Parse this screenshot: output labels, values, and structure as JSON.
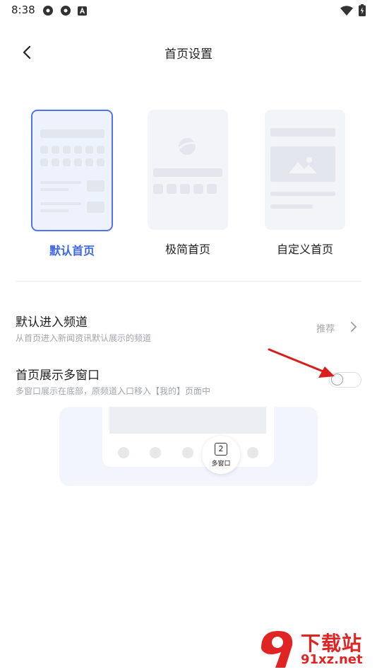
{
  "status_bar": {
    "time": "8:38",
    "left_icons": [
      "app-icon-1",
      "app-icon-2",
      "a-box-icon"
    ],
    "right_icons": [
      "wifi-icon",
      "battery-charging-icon"
    ]
  },
  "nav": {
    "title": "首页设置",
    "back_icon": "chevron-left-icon"
  },
  "layout_options": [
    {
      "label": "默认首页",
      "selected": true
    },
    {
      "label": "极简首页",
      "selected": false
    },
    {
      "label": "自定义首页",
      "selected": false
    }
  ],
  "settings": {
    "default_channel": {
      "title": "默认进入频道",
      "desc": "从首页进入新闻资讯默认展示的频道",
      "value": "推荐"
    },
    "multi_window": {
      "title": "首页展示多窗口",
      "desc": "多窗口展示在底部，原频道入口移入【我的】页面中",
      "enabled": false
    }
  },
  "preview": {
    "badge_count": "2",
    "badge_label": "多窗口"
  },
  "watermark": {
    "title": "下载站",
    "site": "91xz.net"
  },
  "colors": {
    "accent": "#3d66e8",
    "annotation_arrow": "#d81e1e"
  }
}
